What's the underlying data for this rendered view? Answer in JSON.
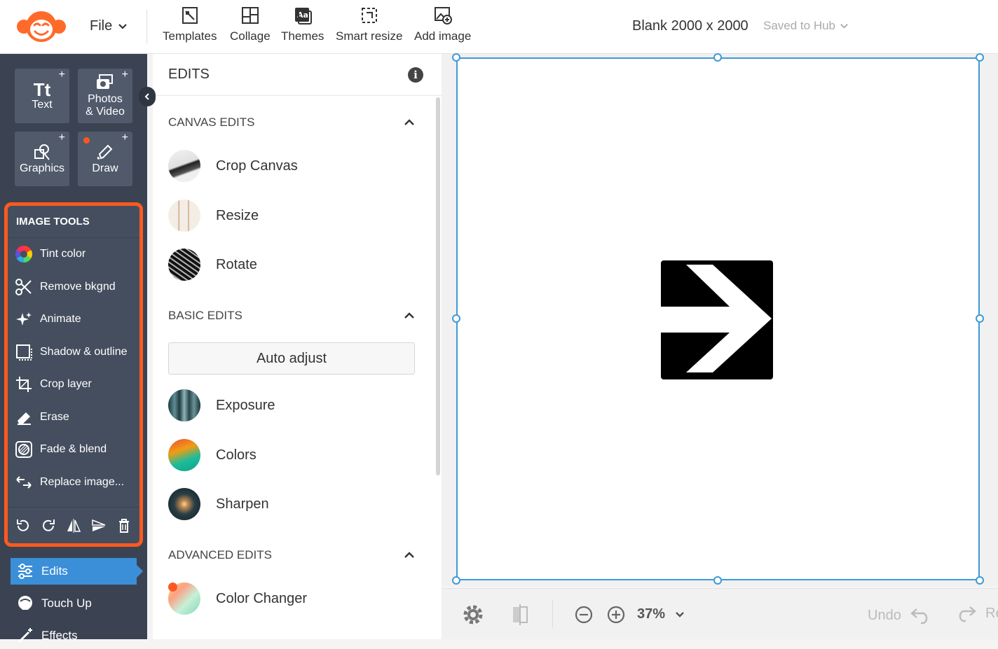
{
  "header": {
    "file_label": "File",
    "tools": [
      {
        "label": "Templates",
        "icon": "templates-icon"
      },
      {
        "label": "Collage",
        "icon": "collage-icon"
      },
      {
        "label": "Themes",
        "icon": "themes-icon"
      },
      {
        "label": "Smart resize",
        "icon": "smart-resize-icon"
      },
      {
        "label": "Add image",
        "icon": "add-image-icon"
      }
    ],
    "doc_title": "Blank 2000 x 2000",
    "saved_label": "Saved to Hub"
  },
  "sidebar": {
    "tiles": [
      {
        "label": "Text",
        "glyph": "Tt"
      },
      {
        "label_line1": "Photos",
        "label_line2": "& Video"
      },
      {
        "label": "Graphics"
      },
      {
        "label": "Draw"
      }
    ],
    "image_tools": {
      "heading": "IMAGE TOOLS",
      "items": [
        {
          "label": "Tint color",
          "icon": "tint-color-icon"
        },
        {
          "label": "Remove bkgnd",
          "icon": "scissors-icon"
        },
        {
          "label": "Animate",
          "icon": "sparkle-icon"
        },
        {
          "label": "Shadow & outline",
          "icon": "shadow-icon"
        },
        {
          "label": "Crop layer",
          "icon": "crop-icon"
        },
        {
          "label": "Erase",
          "icon": "eraser-icon"
        },
        {
          "label": "Fade & blend",
          "icon": "fade-icon"
        },
        {
          "label": "Replace image...",
          "icon": "replace-icon"
        }
      ]
    },
    "nav": [
      {
        "label": "Edits",
        "active": true
      },
      {
        "label": "Touch Up"
      },
      {
        "label": "Effects"
      }
    ]
  },
  "panel": {
    "title": "EDITS",
    "canvas_edits": {
      "heading": "CANVAS EDITS",
      "items": [
        "Crop Canvas",
        "Resize",
        "Rotate"
      ]
    },
    "basic_edits": {
      "heading": "BASIC EDITS",
      "auto_adjust": "Auto adjust",
      "items": [
        "Exposure",
        "Colors",
        "Sharpen"
      ]
    },
    "advanced_edits": {
      "heading": "ADVANCED EDITS",
      "items": [
        "Color Changer"
      ]
    }
  },
  "bottom": {
    "zoom": "37%",
    "undo": "Undo",
    "redo": "Re"
  },
  "colors": {
    "accent_orange": "#ff5a1f",
    "selection_blue": "#3d9ad6",
    "sidebar_bg": "#3b4352"
  }
}
